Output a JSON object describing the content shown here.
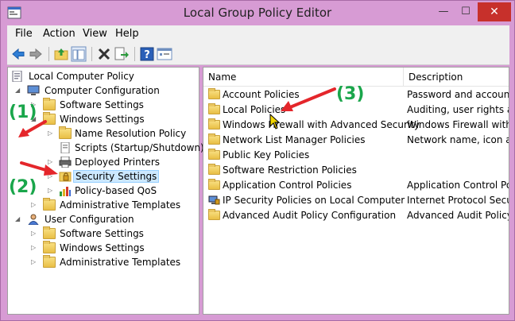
{
  "window": {
    "title": "Local Group Policy Editor"
  },
  "menu": [
    "File",
    "Action",
    "View",
    "Help"
  ],
  "toolbar": {
    "icons": [
      "back-arrow-icon",
      "forward-arrow-icon",
      "up-folder-icon",
      "show-hide-tree-icon",
      "delete-icon",
      "export-list-icon",
      "help-icon",
      "console-tree-icon"
    ]
  },
  "tree": {
    "root": "Local Computer Policy",
    "computer_config": "Computer Configuration",
    "software_settings": "Software Settings",
    "windows_settings": "Windows Settings",
    "name_resolution": "Name Resolution Policy",
    "scripts": "Scripts (Startup/Shutdown)",
    "deployed_printers": "Deployed Printers",
    "security_settings": "Security Settings",
    "qos": "Policy-based QoS",
    "admin_templates": "Administrative Templates",
    "user_config": "User Configuration",
    "user_software_settings": "Software Settings",
    "user_windows_settings": "Windows Settings",
    "user_admin_templates": "Administrative Templates"
  },
  "list": {
    "columns": {
      "name": "Name",
      "description": "Description"
    },
    "rows": [
      {
        "name": "Account Policies",
        "description": "Password and account lo",
        "icon": "folder"
      },
      {
        "name": "Local Policies",
        "description": "Auditing, user rights and",
        "icon": "folder"
      },
      {
        "name": "Windows Firewall with Advanced Security",
        "description": "Windows Firewall with A",
        "icon": "folder"
      },
      {
        "name": "Network List Manager Policies",
        "description": "Network name, icon and",
        "icon": "folder"
      },
      {
        "name": "Public Key Policies",
        "description": "",
        "icon": "folder"
      },
      {
        "name": "Software Restriction Policies",
        "description": "",
        "icon": "folder"
      },
      {
        "name": "Application Control Policies",
        "description": "Application Control Poli",
        "icon": "folder"
      },
      {
        "name": "IP Security Policies on Local Computer",
        "description": "Internet Protocol Securit",
        "icon": "ip-security"
      },
      {
        "name": "Advanced Audit Policy Configuration",
        "description": "Advanced Audit Policy C",
        "icon": "folder"
      }
    ]
  },
  "annotations": {
    "a1": "(1)",
    "a2": "(2)",
    "a3": "(3)"
  },
  "colors": {
    "window_frame": "#d79bd4",
    "close_button": "#c7302b",
    "annotation_green": "#1aa64b",
    "arrow_red": "#e4262b",
    "selection": "#cce8ff"
  }
}
